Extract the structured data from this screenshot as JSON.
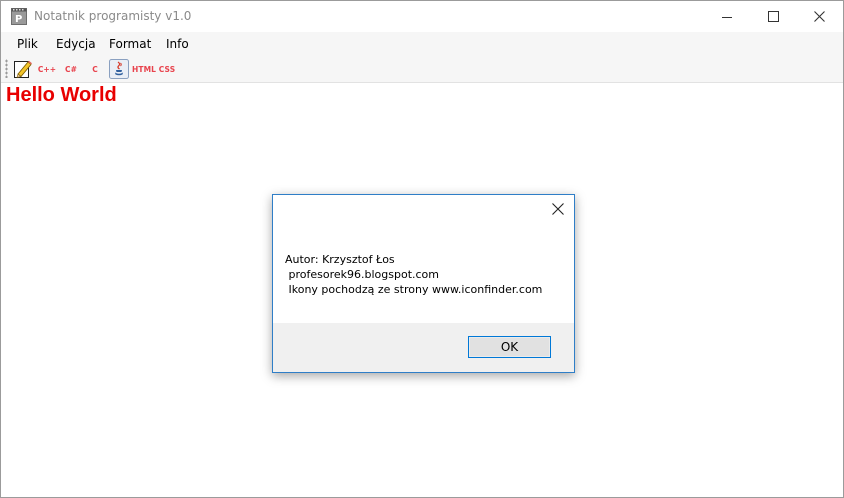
{
  "window": {
    "title": "Notatnik programisty v1.0"
  },
  "menu": {
    "items": [
      "Plik",
      "Edycja",
      "Format",
      "Info"
    ]
  },
  "toolbar": {
    "buttons": [
      {
        "icon": "pencil-icon"
      },
      {
        "label": "C++"
      },
      {
        "label": "C#"
      },
      {
        "label": "C"
      },
      {
        "icon": "java-icon"
      },
      {
        "label": "HTML"
      },
      {
        "label": "CSS"
      }
    ]
  },
  "editor": {
    "content": "Hello World",
    "text_color": "#e80000"
  },
  "dialog": {
    "lines": [
      "Autor: Krzysztof Łos",
      " profesorek96.blogspot.com",
      " Ikony pochodzą ze strony www.iconfinder.com"
    ],
    "ok_label": "OK",
    "accent": "#0078d7"
  }
}
